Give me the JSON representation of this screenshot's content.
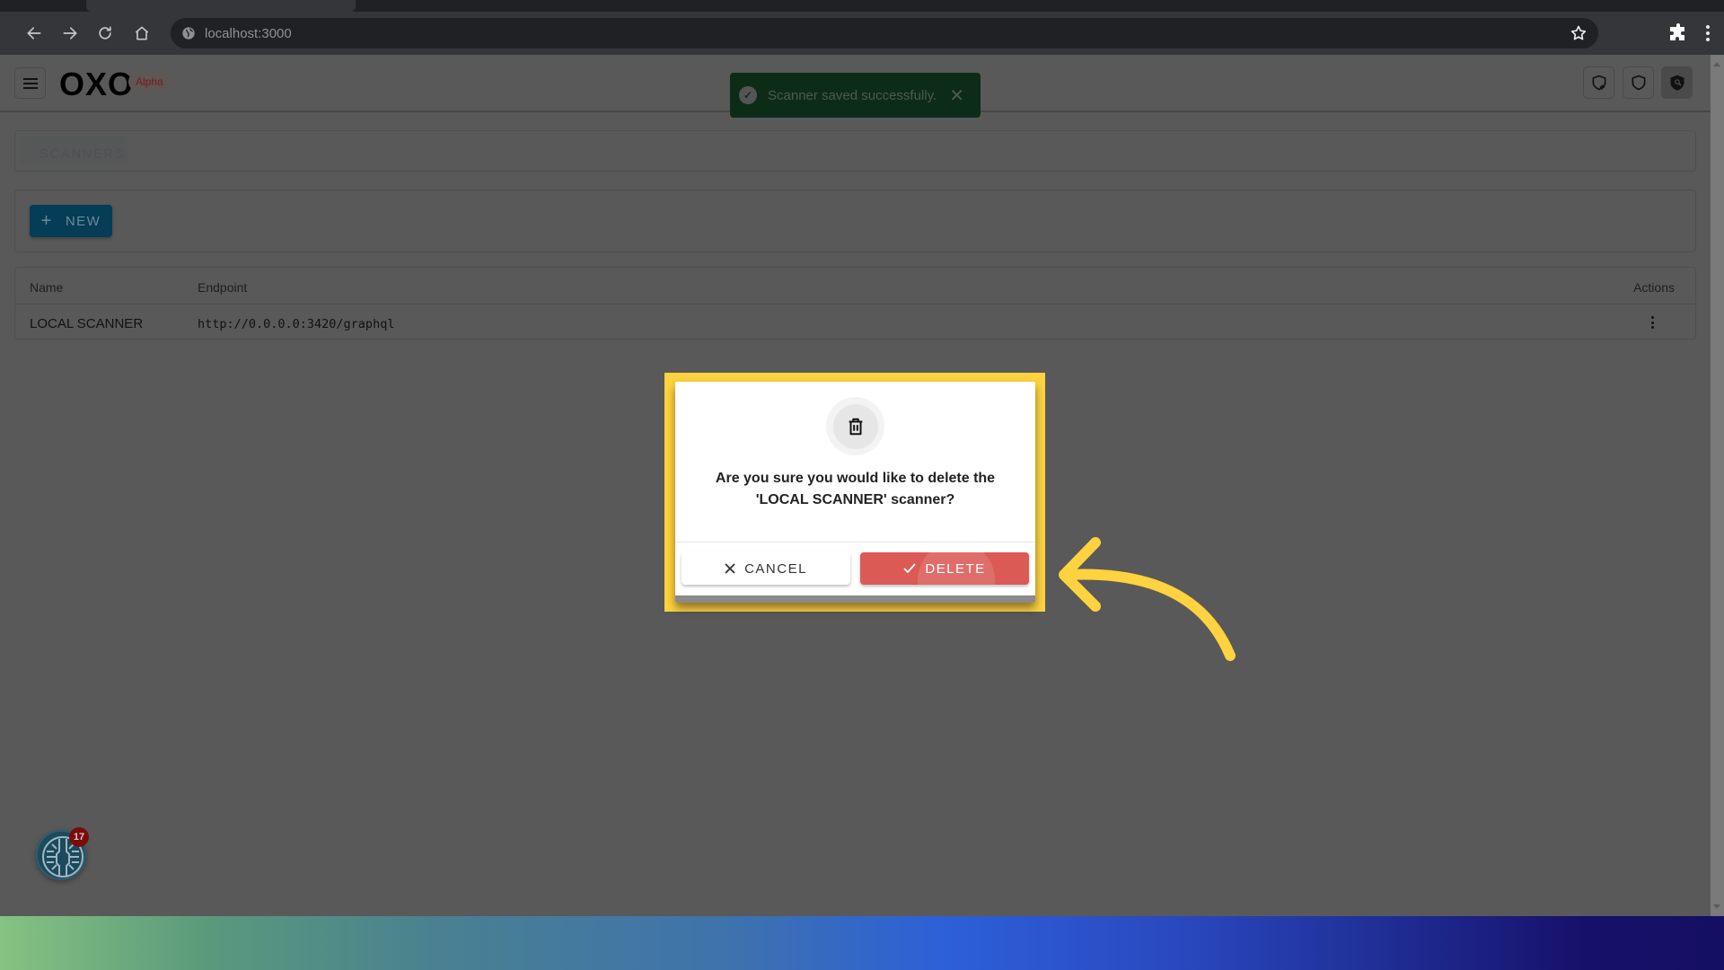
{
  "browser": {
    "url": "localhost:3000",
    "icons": [
      "back-icon",
      "forward-icon",
      "reload-icon",
      "home-icon",
      "site-info-icon",
      "bookmark-star-icon",
      "extensions-icon",
      "browser-menu-icon"
    ]
  },
  "app": {
    "logo": "OXO",
    "badge": "Alpha",
    "header_icons": [
      "shield-plus-icon",
      "shield-icon",
      "shield-search-icon"
    ]
  },
  "toast": {
    "message": "Scanner saved successfully.",
    "close": "✕",
    "status_color": "#1b5e20"
  },
  "breadcrumb": {
    "label": "SCANNERS"
  },
  "actions": {
    "new_label": "NEW",
    "new_icon": "+"
  },
  "table": {
    "columns": [
      "Name",
      "Endpoint",
      "Actions"
    ],
    "rows": [
      {
        "name": "LOCAL SCANNER",
        "endpoint": "http://0.0.0.0:3420/graphql"
      }
    ]
  },
  "fab": {
    "badge_count": "17"
  },
  "dialog": {
    "question": "Are you sure you would like to delete the 'LOCAL SCANNER' scanner?",
    "cancel_label": "CANCEL",
    "delete_label": "DELETE",
    "delete_color": "#db5a56",
    "highlight_color": "#ffd23f"
  }
}
